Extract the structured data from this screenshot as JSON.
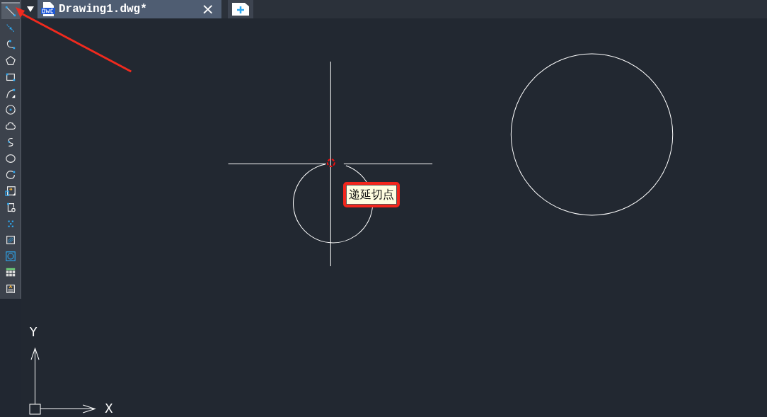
{
  "toolbar": {
    "tools": [
      {
        "kind": "line",
        "selected": true
      },
      {
        "kind": "xline",
        "selected": false
      },
      {
        "kind": "polyline",
        "selected": false
      },
      {
        "kind": "polygon",
        "selected": false
      },
      {
        "kind": "rectangle",
        "selected": false
      },
      {
        "kind": "arc",
        "selected": false
      },
      {
        "kind": "circle",
        "selected": false
      },
      {
        "kind": "cloud",
        "selected": false
      },
      {
        "kind": "spline",
        "selected": false
      },
      {
        "kind": "ellipse",
        "selected": false
      },
      {
        "kind": "ellipse-arc",
        "selected": false
      },
      {
        "kind": "insert-block",
        "selected": false
      },
      {
        "kind": "make-block",
        "selected": false
      },
      {
        "kind": "points",
        "selected": false
      },
      {
        "kind": "hatch",
        "selected": false
      },
      {
        "kind": "region",
        "selected": false
      },
      {
        "kind": "table",
        "selected": false
      },
      {
        "kind": "mtext",
        "selected": false
      }
    ]
  },
  "tabs": [
    {
      "title": "Drawing1.dwg*",
      "selected": true,
      "close": "×"
    }
  ],
  "tooltip": {
    "text": "递延切点"
  },
  "ucs": {
    "x_label": "X",
    "y_label": "Y"
  }
}
